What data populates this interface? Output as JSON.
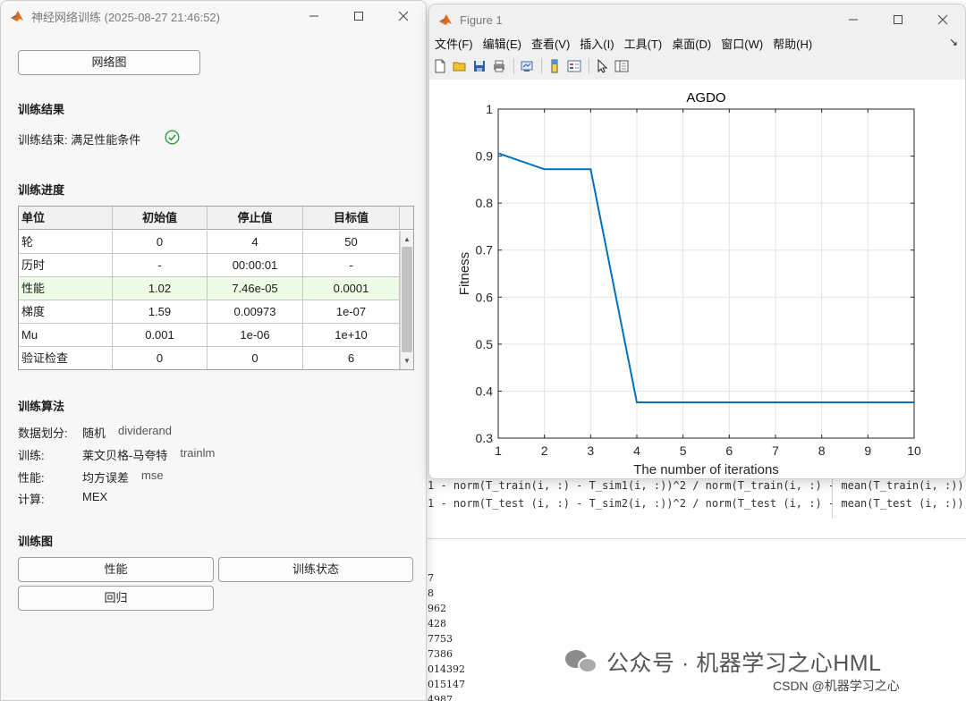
{
  "background": {
    "code_lines": [
      "1 - norm(T_train(i, :) - T_sim1(i, :))^2 / norm(T_train(i, :) - mean(T_train(i, :)))^",
      "1 - norm(T_test (i, :) - T_sim2(i, :))^2 / norm(T_test (i, :) - mean(T_test (i, :)))^"
    ],
    "command_output": [
      "7",
      "8",
      "962",
      "428",
      "7753",
      "7386",
      "014392",
      "015147",
      "4987"
    ],
    "watermark": "公众号 · 机器学习之心HML",
    "csdn": "CSDN @机器学习之心"
  },
  "train_window": {
    "title": "神经网络训练 (2025-08-27 21:46:52)",
    "network_button": "网络图",
    "result": {
      "heading": "训练结果",
      "text": "训练结束: 满足性能条件"
    },
    "progress": {
      "heading": "训练进度",
      "columns": [
        "单位",
        "初始值",
        "停止值",
        "目标值"
      ],
      "rows": [
        [
          "轮",
          "0",
          "4",
          "50"
        ],
        [
          "历时",
          "-",
          "00:00:01",
          "-"
        ],
        [
          "性能",
          "1.02",
          "7.46e-05",
          "0.0001"
        ],
        [
          "梯度",
          "1.59",
          "0.00973",
          "1e-07"
        ],
        [
          "Mu",
          "0.001",
          "1e-06",
          "1e+10"
        ],
        [
          "验证检查",
          "0",
          "0",
          "6"
        ]
      ]
    },
    "algorithms": {
      "heading": "训练算法",
      "items": [
        {
          "key": "数据划分:",
          "value": "随机",
          "code": "dividerand"
        },
        {
          "key": "训练:",
          "value": "莱文贝格-马夸特",
          "code": "trainlm"
        },
        {
          "key": "性能:",
          "value": "均方误差",
          "code": "mse"
        },
        {
          "key": "计算:",
          "value": "MEX",
          "code": ""
        }
      ]
    },
    "plots": {
      "heading": "训练图",
      "performance_button": "性能",
      "state_button": "训练状态",
      "regression_button": "回归"
    }
  },
  "figure_window": {
    "title": "Figure 1",
    "menu": [
      "文件(F)",
      "编辑(E)",
      "查看(V)",
      "插入(I)",
      "工具(T)",
      "桌面(D)",
      "窗口(W)",
      "帮助(H)"
    ],
    "menu_arrow": "↘"
  },
  "chart_data": {
    "type": "line",
    "title": "AGDO",
    "xlabel": "The number of iterations",
    "ylabel": "Fitness",
    "xlim": [
      1,
      10
    ],
    "ylim": [
      0.3,
      1
    ],
    "xticks": [
      "1",
      "2",
      "3",
      "4",
      "5",
      "6",
      "7",
      "8",
      "9",
      "10"
    ],
    "yticks": [
      "0.3",
      "0.4",
      "0.5",
      "0.6",
      "0.7",
      "0.8",
      "0.9",
      "1"
    ],
    "grid": true,
    "color": "#0072BD",
    "x": [
      1,
      2,
      3,
      4,
      5,
      6,
      7,
      8,
      9,
      10
    ],
    "y": [
      0.906,
      0.872,
      0.872,
      0.376,
      0.376,
      0.376,
      0.376,
      0.376,
      0.376,
      0.376
    ]
  }
}
